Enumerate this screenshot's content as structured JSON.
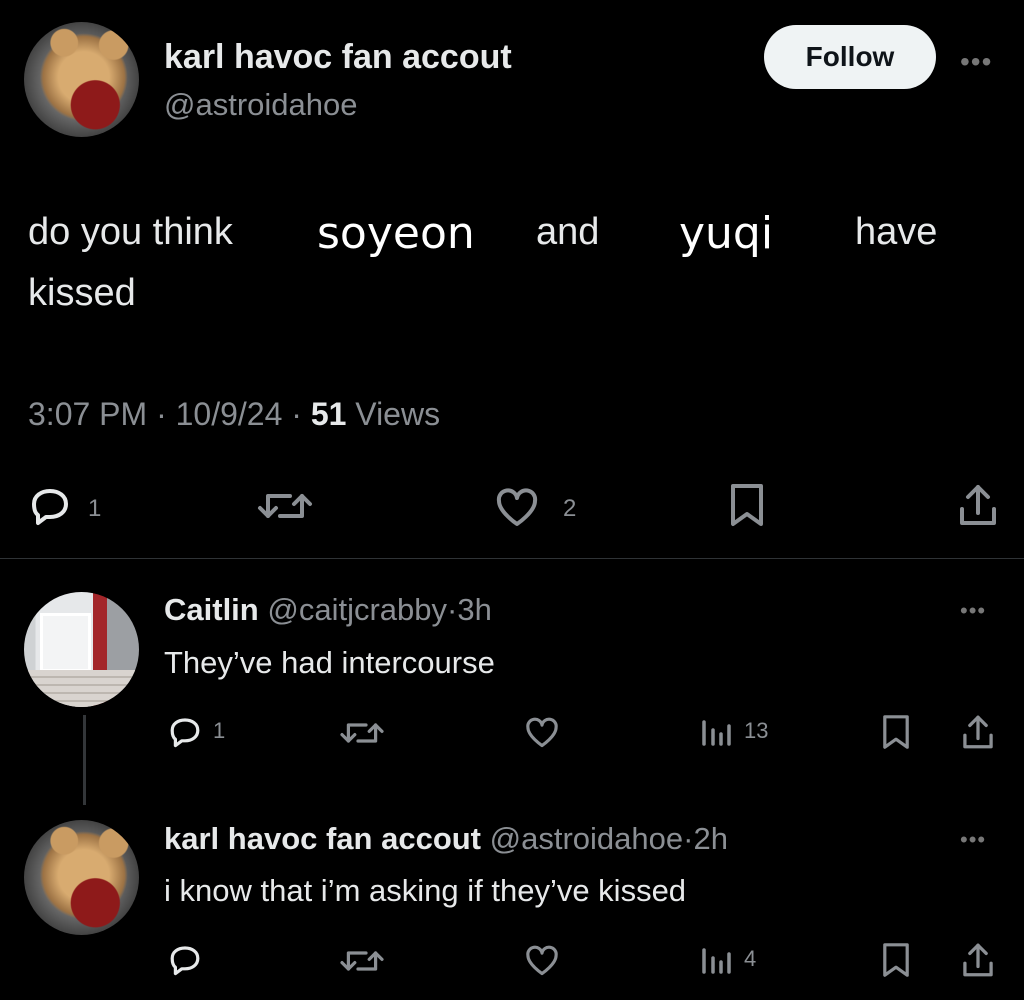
{
  "main_tweet": {
    "display_name": "karl havoc fan accout",
    "handle": "@astroidahoe",
    "follow_label": "Follow",
    "more_label": "•••",
    "text": {
      "part1": "do you think",
      "part2": "soyeon",
      "part3": "and",
      "part4": "yuqi",
      "part5": "have",
      "part6": "kissed"
    },
    "time": "3:07 PM",
    "date": "10/9/24",
    "views_count": "51",
    "views_label": "Views",
    "dot": "·",
    "reply_count": "1",
    "like_count": "2"
  },
  "replies": [
    {
      "display_name": "Caitlin",
      "handle": "@caitjcrabby",
      "age": "3h",
      "text": "They’ve had intercourse",
      "reply_count": "1",
      "view_count": "13",
      "more_label": "•••"
    },
    {
      "display_name": "karl havoc fan accout",
      "handle": "@astroidahoe",
      "age": "2h",
      "text": "i know that i’m asking if they’ve kissed",
      "view_count": "4",
      "more_label": "•••"
    }
  ],
  "colors": {
    "background": "#000000",
    "text_primary": "#e7e9ea",
    "text_muted": "#8b8f94",
    "follow_bg": "#eff3f4"
  },
  "icons": [
    "reply-icon",
    "retweet-icon",
    "like-icon",
    "bookmark-icon",
    "share-icon",
    "views-icon",
    "more-icon"
  ]
}
